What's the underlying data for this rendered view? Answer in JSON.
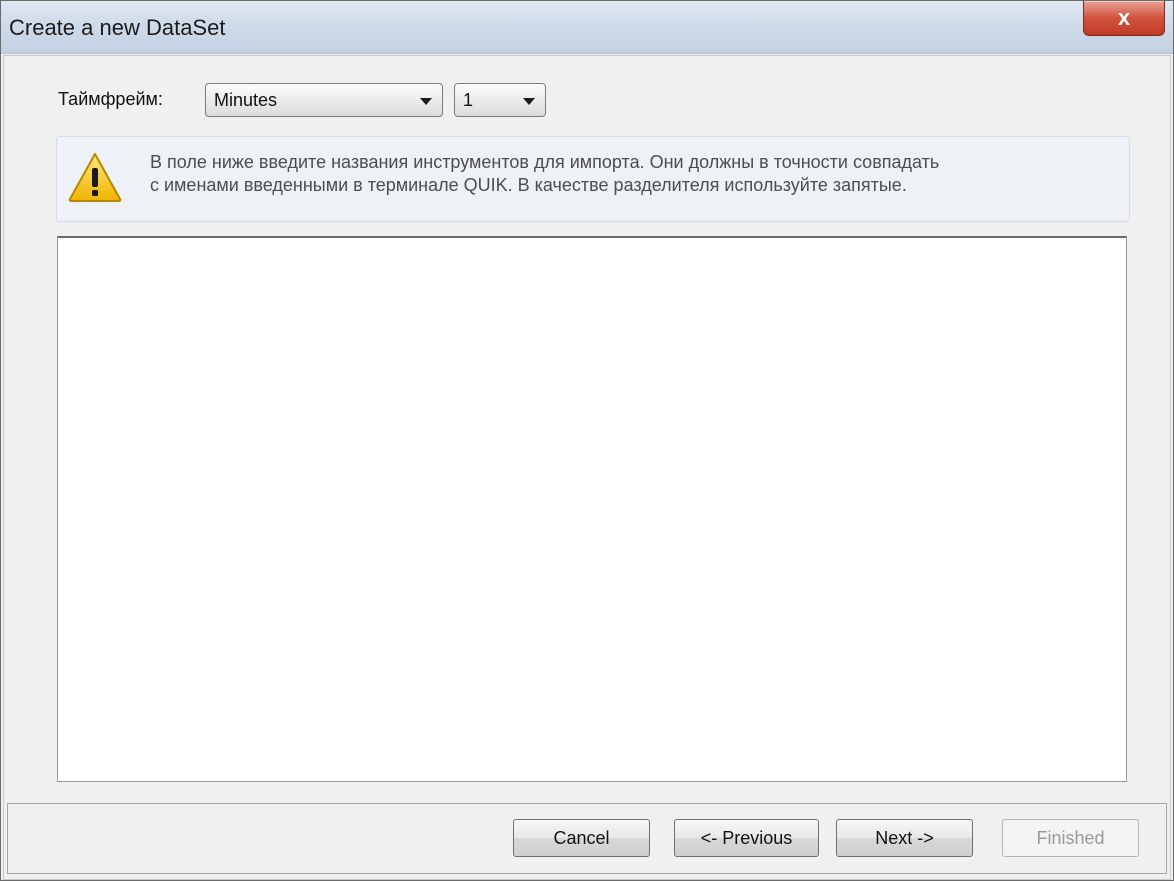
{
  "window": {
    "title": "Create a new DataSet",
    "close_glyph": "x"
  },
  "timeframe": {
    "label": "Таймфрейм:",
    "unit_value": "Minutes",
    "interval_value": "1"
  },
  "info": {
    "icon": "warning-icon",
    "line1": "В поле ниже введите названия инструментов для импорта. Они должны в точности совпадать",
    "line2": "с именами введенными в терминале QUIK. В качестве разделителя используйте запятые."
  },
  "instruments": {
    "value": ""
  },
  "buttons": {
    "cancel": "Cancel",
    "previous": "<- Previous",
    "next": "Next ->",
    "finished": "Finished"
  }
}
